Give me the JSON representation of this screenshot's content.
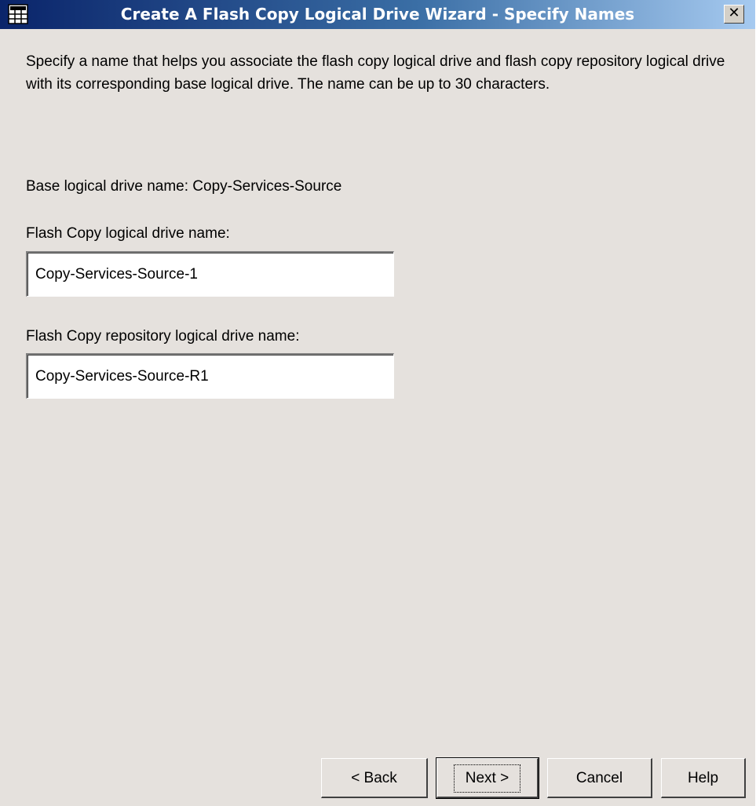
{
  "window": {
    "title": "Create A Flash Copy Logical Drive Wizard - Specify Names",
    "icon": "grid-app-icon",
    "close_glyph": "✕"
  },
  "intro_text": "Specify a name that helps you associate the flash copy logical drive and flash copy repository logical drive with its corresponding base logical drive. The name can be up to 30 characters.",
  "base_drive": {
    "label": "Base logical drive name: Copy-Services-Source"
  },
  "flash_copy_field": {
    "label": "Flash Copy logical drive name:",
    "value": "Copy-Services-Source-1"
  },
  "repository_field": {
    "label": "Flash Copy repository logical drive name:",
    "value": "Copy-Services-Source-R1"
  },
  "buttons": {
    "back": "< Back",
    "next": "Next >",
    "cancel": "Cancel",
    "help": "Help"
  },
  "colors": {
    "dialog_background": "#e5e1dd",
    "titlebar_start": "#0a246a",
    "titlebar_end": "#a6caf0"
  }
}
